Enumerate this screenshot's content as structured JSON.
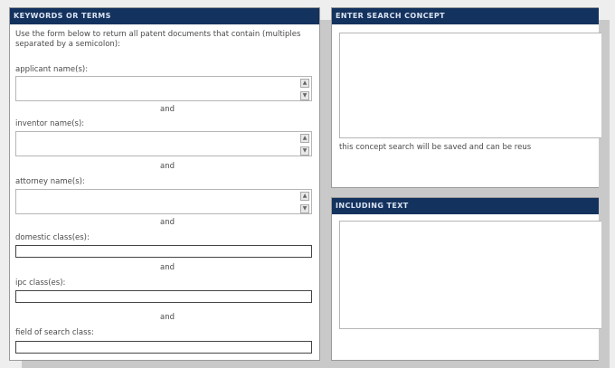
{
  "keywords_panel": {
    "header": "KEYWORDS OR TERMS",
    "intro": "Use the form below to return all patent documents that contain (multiples separated by a semicolon):",
    "fields": {
      "applicant": "applicant name(s):",
      "inventor": "inventor name(s):",
      "attorney": "attorney name(s):",
      "domestic_class": "domestic class(es):",
      "ipc_class": "ipc class(es):",
      "field_of_search": "field of search class:"
    },
    "connector": "and"
  },
  "concept_panel": {
    "header": "ENTER SEARCH CONCEPT",
    "note": "this concept search will be saved and can be reus"
  },
  "including_panel": {
    "header": "INCLUDING TEXT"
  },
  "colors": {
    "header_bg": "#14325e",
    "header_text": "#dbe4f2"
  }
}
